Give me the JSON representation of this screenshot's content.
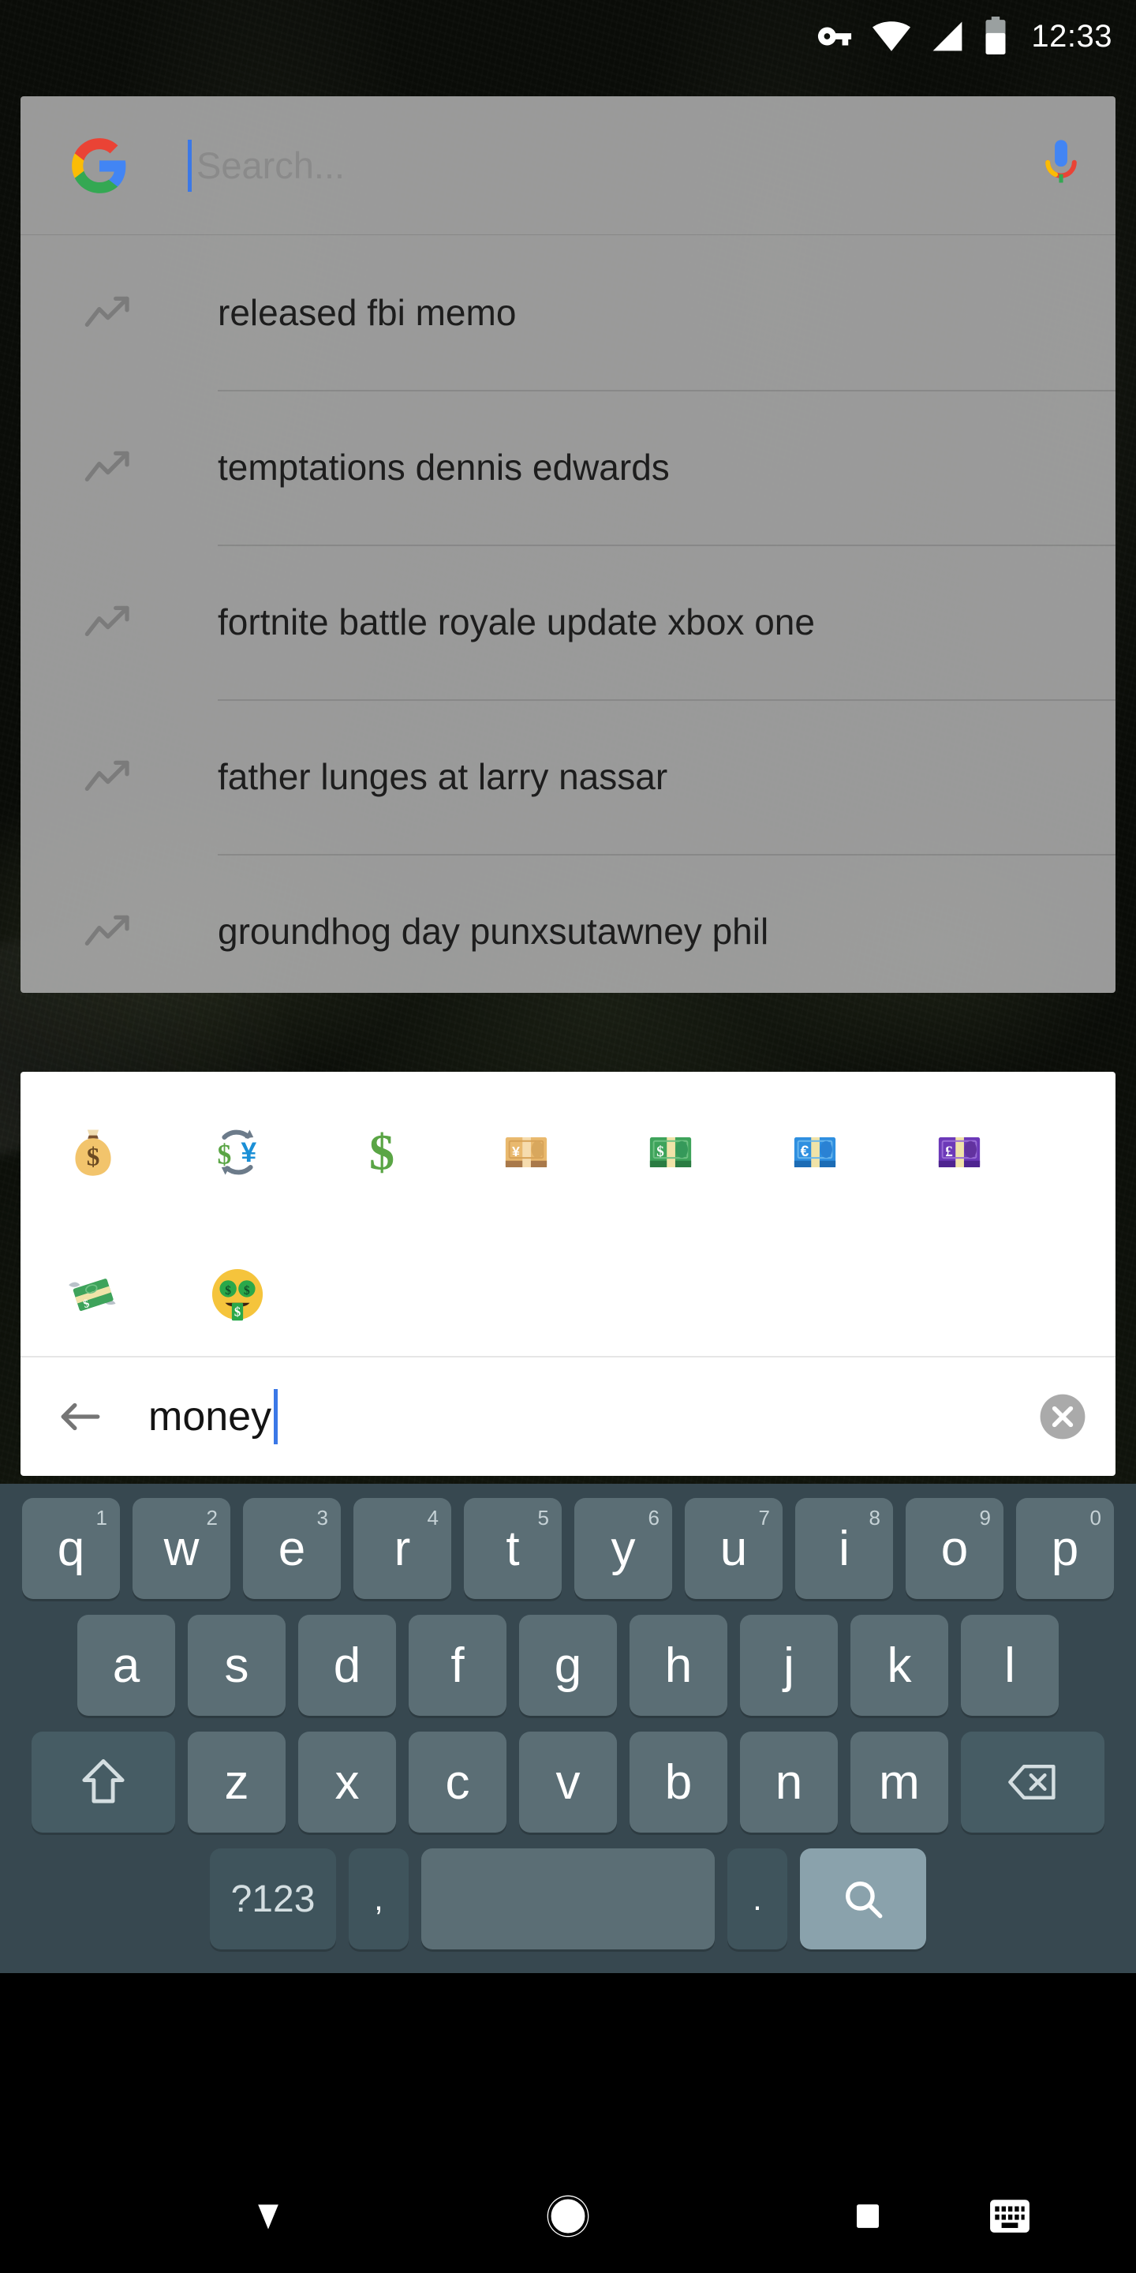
{
  "status_bar": {
    "time": "12:33",
    "icons": [
      "vpn-key-icon",
      "wifi-icon",
      "cellular-signal-icon",
      "battery-icon"
    ]
  },
  "search_widget": {
    "logo": "google-g-logo",
    "placeholder": "Search...",
    "mic_label": "voice-search-icon",
    "suggestions": [
      {
        "icon": "trending-up-icon",
        "text": "released fbi memo"
      },
      {
        "icon": "trending-up-icon",
        "text": "temptations dennis edwards"
      },
      {
        "icon": "trending-up-icon",
        "text": "fortnite battle royale update xbox one"
      },
      {
        "icon": "trending-up-icon",
        "text": "father lunges at larry nassar"
      },
      {
        "icon": "trending-up-icon",
        "text": "groundhog day punxsutawney phil"
      }
    ]
  },
  "emoji_panel": {
    "results": [
      [
        {
          "name": "money-bag-emoji",
          "char": "💰"
        },
        {
          "name": "currency-exchange-emoji",
          "char": "💱"
        },
        {
          "name": "heavy-dollar-sign-emoji",
          "char": "💲"
        },
        {
          "name": "yen-banknote-emoji",
          "char": "💴"
        },
        {
          "name": "dollar-banknote-emoji",
          "char": "💵"
        },
        {
          "name": "euro-banknote-emoji",
          "char": "💶"
        },
        {
          "name": "pound-banknote-emoji",
          "char": "💷"
        }
      ],
      [
        {
          "name": "money-with-wings-emoji",
          "char": "💸"
        },
        {
          "name": "money-mouth-face-emoji",
          "char": "🤑"
        }
      ]
    ],
    "search": {
      "back_label": "back-arrow-icon",
      "query": "money",
      "clear_label": "clear-input-icon"
    }
  },
  "keyboard": {
    "rows": [
      [
        {
          "label": "q",
          "sup": "1"
        },
        {
          "label": "w",
          "sup": "2"
        },
        {
          "label": "e",
          "sup": "3"
        },
        {
          "label": "r",
          "sup": "4"
        },
        {
          "label": "t",
          "sup": "5"
        },
        {
          "label": "y",
          "sup": "6"
        },
        {
          "label": "u",
          "sup": "7"
        },
        {
          "label": "i",
          "sup": "8"
        },
        {
          "label": "o",
          "sup": "9"
        },
        {
          "label": "p",
          "sup": "0"
        }
      ],
      [
        {
          "label": "a"
        },
        {
          "label": "s"
        },
        {
          "label": "d"
        },
        {
          "label": "f"
        },
        {
          "label": "g"
        },
        {
          "label": "h"
        },
        {
          "label": "j"
        },
        {
          "label": "k"
        },
        {
          "label": "l"
        }
      ],
      [
        {
          "label": "z"
        },
        {
          "label": "x"
        },
        {
          "label": "c"
        },
        {
          "label": "v"
        },
        {
          "label": "b"
        },
        {
          "label": "n"
        },
        {
          "label": "m"
        }
      ]
    ],
    "shift_label": "shift-key-icon",
    "backspace_label": "backspace-key-icon",
    "symbols_label": "?123",
    "comma_label": ",",
    "space_label": "",
    "period_label": ".",
    "enter_label": "search-key-icon"
  },
  "nav_bar": {
    "back_label": "hide-keyboard-icon",
    "home_label": "home-icon",
    "recents_label": "recents-icon",
    "keyboard_switch_label": "switch-keyboard-icon"
  },
  "colors": {
    "keyboard_bg": "#374850",
    "key_bg": "#5b6e75",
    "key_fn_bg": "#3f545c",
    "enter_key_bg": "#8aa2ac",
    "widget_bg": "#aaaaaa",
    "panel_bg": "#ffffff",
    "caret": "#3b78e7",
    "navbar_bg": "#000000"
  }
}
